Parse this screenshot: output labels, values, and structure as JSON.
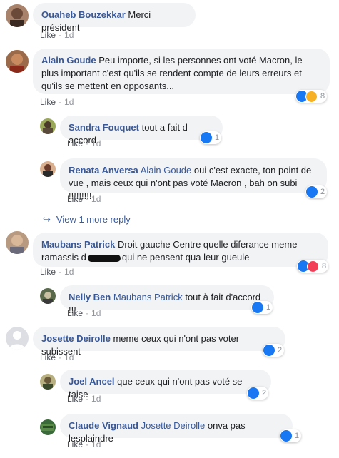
{
  "like_label": "Like",
  "time_label": "1d",
  "comments": [
    {
      "name": "Ouaheb Bouzekkar",
      "text": "Merci président"
    },
    {
      "name": "Alain Goude",
      "text": "Peu importe, si les personnes ont voté Macron, le plus important c'est qu'ils se rendent compte de leurs erreurs et qu'ils se mettent en opposants...",
      "reactions": "8"
    },
    {
      "name": "Sandra Fouquet",
      "text": "tout a fait d accord",
      "reactions": "1"
    },
    {
      "name": "Renata Anversa",
      "mention": "Alain Goude",
      "text": "oui c'est exacte, ton point de vue , mais ceux qui n'ont pas voté Macron , bah on subi !!!!!!!!!",
      "reactions": "2"
    },
    {
      "name": "Maubans Patrick",
      "text_a": "Droit gauche Centre quelle diferance meme ramassis d",
      "text_b": "qui ne pensent qua leur gueule",
      "reactions": "8"
    },
    {
      "name": "Nelly Ben",
      "mention": "Maubans Patrick",
      "text": "tout à fait d'accord !!!",
      "reactions": "1"
    },
    {
      "name": "Josette Deirolle",
      "text": "meme ceux qui n'ont pas voter subissent",
      "reactions": "2"
    },
    {
      "name": "Joel Ancel",
      "text": "que ceux qui n'ont pas voté se taise",
      "reactions": "2"
    },
    {
      "name": "Claude Vignaud",
      "mention": "Josette Deirolle",
      "text": "onva pas lesplaindre",
      "reactions": "1"
    }
  ],
  "view_more": "View 1 more reply"
}
